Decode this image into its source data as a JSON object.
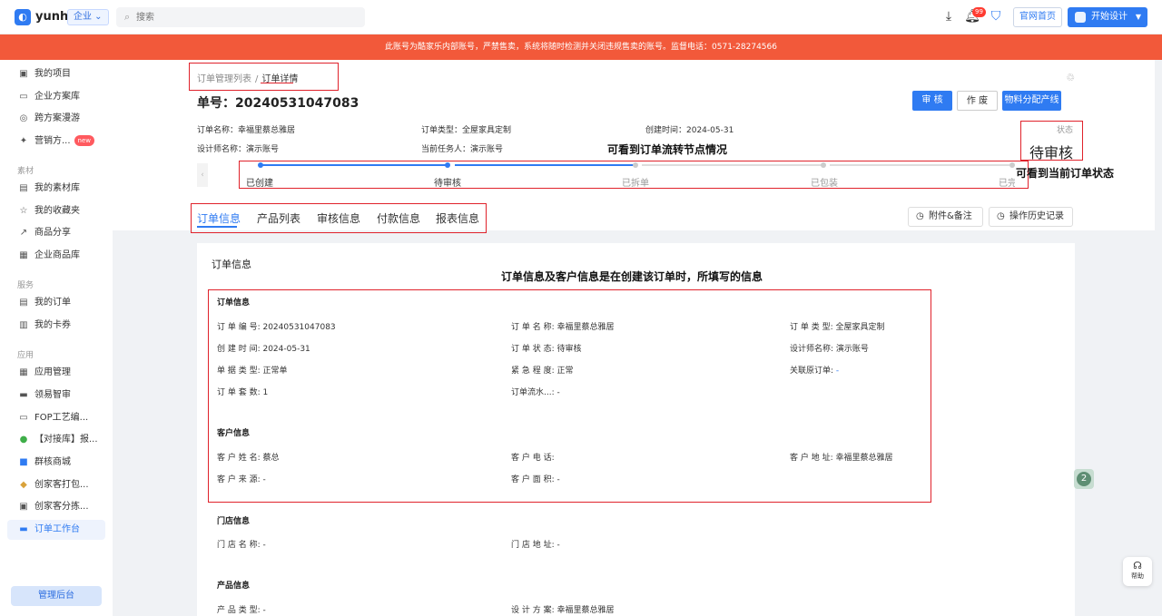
{
  "topbar": {
    "app_name": "yunhe",
    "tier": "企业",
    "search_placeholder": "搜索",
    "notification_count": "99",
    "site_button": "官网首页",
    "design_button": "开始设计"
  },
  "banner": {
    "text": "此账号为酷家乐内部账号，严禁售卖，系统将随时检测并关闭违规售卖的账号。监督电话：0571-28274566"
  },
  "sidebar": {
    "items_top": [
      {
        "label": "我的项目"
      },
      {
        "label": "企业方案库"
      },
      {
        "label": "跨方案漫游"
      },
      {
        "label": "营销方...",
        "badge": "new"
      }
    ],
    "group_material": "素材",
    "items_material": [
      {
        "label": "我的素材库"
      },
      {
        "label": "我的收藏夹"
      },
      {
        "label": "商品分享"
      },
      {
        "label": "企业商品库"
      }
    ],
    "group_service": "服务",
    "items_service": [
      {
        "label": "我的订单"
      },
      {
        "label": "我的卡券"
      }
    ],
    "group_app": "应用",
    "items_app": [
      {
        "label": "应用管理"
      },
      {
        "label": "领易智审"
      },
      {
        "label": "FOP工艺编..."
      },
      {
        "label": "【对接库】报..."
      },
      {
        "label": "群核商城"
      },
      {
        "label": "创家客打包..."
      },
      {
        "label": "创家客分拣..."
      },
      {
        "label": "订单工作台"
      }
    ],
    "admin_button": "管理后台"
  },
  "header": {
    "breadcrumb": [
      "订单管理列表",
      "订单详情"
    ],
    "breadcrumb_sep": "/",
    "order_title": "单号：20240531047083",
    "buttons": {
      "review": "审 核",
      "void": "作 废",
      "material": "物料分配产线"
    },
    "meta": {
      "order_name": "订单名称：幸福里蔡总雅居",
      "order_type": "订单类型：全屋家具定制",
      "created": "创建时间：2024-05-31",
      "designer": "设计师名称：演示账号",
      "assignee": "当前任务人：演示账号"
    },
    "status_label": "状态",
    "status_value": "待审核",
    "steps": [
      "已创建",
      "待审核",
      "已拆单",
      "已包装",
      "已完"
    ],
    "steps_done": 2,
    "tabs": [
      "订单信息",
      "产品列表",
      "审核信息",
      "付款信息",
      "报表信息"
    ],
    "attach_button": "附件&备注",
    "history_button": "操作历史记录"
  },
  "annotations": {
    "flow": "可看到订单流转节点情况",
    "status": "可看到当前订单状态",
    "info": "订单信息及客户信息是在创建该订单时，所填写的信息"
  },
  "content": {
    "title": "订单信息",
    "order_section": "订单信息",
    "order_fields": {
      "order_no": "订 单 编 号: 20240531047083",
      "order_name": "订 单 名 称: 幸福里蔡总雅居",
      "order_type": "订 单 类 型: 全屋家具定制",
      "created": "创 建 时 间: 2024-05-31",
      "order_status": "订 单 状 态: 待审核",
      "designer": "设计师名称: 演示账号",
      "doc_type": "单 据 类 型: 正常单",
      "urgency": "紧 急 程 度: 正常",
      "related_label": "关联原订单:",
      "related_value": " -",
      "sets": "订 单 套 数: 1",
      "flow": "订单流水...: -"
    },
    "customer_section": "客户信息",
    "customer_fields": {
      "name": "客 户 姓 名: 蔡总",
      "phone": "客 户 电 话:",
      "address": "客 户 地 址: 幸福里蔡总雅居",
      "source": "客 户 来 源: -",
      "area": "客 户 面 积: -"
    },
    "store_section": "门店信息",
    "store_fields": {
      "name": "门 店 名 称: -",
      "address": "门 店 地 址: -"
    },
    "product_section": "产品信息",
    "product_fields": {
      "type": "产 品 类 型: -",
      "plan": "设 计 方 案: 幸福里蔡总雅居"
    }
  },
  "float": {
    "badge": "2",
    "help": "帮助"
  }
}
